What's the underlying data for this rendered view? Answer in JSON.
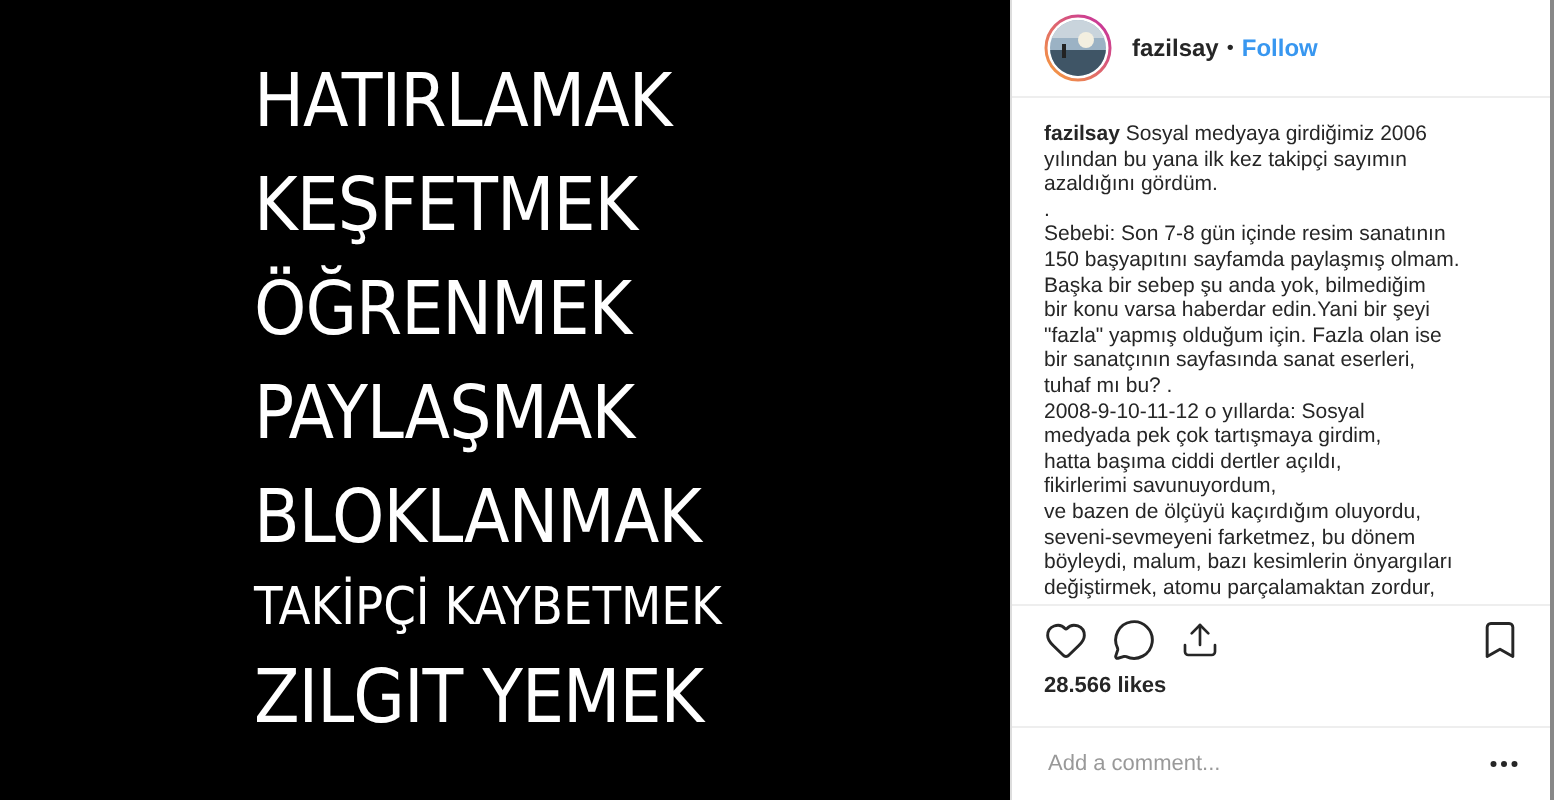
{
  "post_image": {
    "lines": [
      {
        "text": "HATIRLAMAK",
        "kind": "large"
      },
      {
        "text": "KEŞFETMEK",
        "kind": "large"
      },
      {
        "text": "ÖĞRENMEK",
        "kind": "large"
      },
      {
        "text": "PAYLAŞMAK",
        "kind": "large"
      },
      {
        "text": "BLOKLANMAK",
        "kind": "large"
      },
      {
        "text": "TAKİPÇİ KAYBETMEK",
        "kind": "small"
      },
      {
        "text": "ZILGIT YEMEK",
        "kind": "large"
      }
    ]
  },
  "header": {
    "username": "fazilsay",
    "separator": "•",
    "follow": "Follow"
  },
  "caption": {
    "username": "fazilsay",
    "lines": [
      "Sosyal medyaya girdiğimiz 2006",
      "yılından bu yana ilk kez takipçi sayımın",
      "azaldığını gördüm.",
      ".",
      "Sebebi: Son 7-8 gün içinde resim sanatının",
      "150 başyapıtını sayfamda paylaşmış olmam.",
      "Başka bir sebep şu anda yok, bilmediğim",
      "bir konu varsa haberdar edin.Yani bir şeyi",
      "\"fazla\" yapmış olduğum için. Fazla olan ise",
      "bir sanatçının sayfasında sanat eserleri,",
      "tuhaf mı bu? .",
      "2008-9-10-11-12 o yıllarda: Sosyal",
      "medyada pek çok tartışmaya girdim,",
      "hatta başıma ciddi dertler açıldı,",
      "fikirlerimi savunuyordum,",
      "ve bazen de ölçüyü kaçırdığım oluyordu,",
      "seveni-sevmeyeni farketmez, bu dönem",
      "böyleydi, malum, bazı kesimlerin önyargıları",
      "değiştirmek, atomu parçalamaktan zordur,"
    ]
  },
  "likes": "28.566 likes",
  "comment": {
    "placeholder": "Add a comment..."
  }
}
